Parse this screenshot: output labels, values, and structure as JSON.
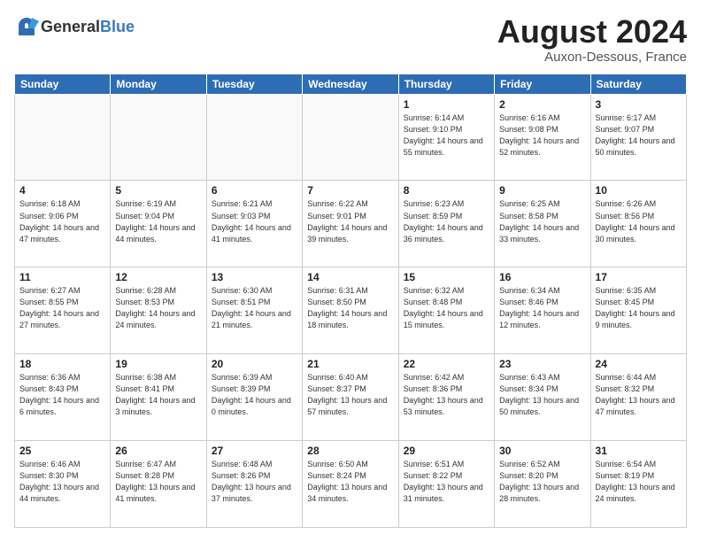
{
  "logo": {
    "general": "General",
    "blue": "Blue"
  },
  "header": {
    "month": "August 2024",
    "location": "Auxon-Dessous, France"
  },
  "weekdays": [
    "Sunday",
    "Monday",
    "Tuesday",
    "Wednesday",
    "Thursday",
    "Friday",
    "Saturday"
  ],
  "weeks": [
    [
      {
        "day": null
      },
      {
        "day": null
      },
      {
        "day": null
      },
      {
        "day": null
      },
      {
        "day": 1,
        "sunrise": "Sunrise: 6:14 AM",
        "sunset": "Sunset: 9:10 PM",
        "daylight": "Daylight: 14 hours and 55 minutes."
      },
      {
        "day": 2,
        "sunrise": "Sunrise: 6:16 AM",
        "sunset": "Sunset: 9:08 PM",
        "daylight": "Daylight: 14 hours and 52 minutes."
      },
      {
        "day": 3,
        "sunrise": "Sunrise: 6:17 AM",
        "sunset": "Sunset: 9:07 PM",
        "daylight": "Daylight: 14 hours and 50 minutes."
      }
    ],
    [
      {
        "day": 4,
        "sunrise": "Sunrise: 6:18 AM",
        "sunset": "Sunset: 9:06 PM",
        "daylight": "Daylight: 14 hours and 47 minutes."
      },
      {
        "day": 5,
        "sunrise": "Sunrise: 6:19 AM",
        "sunset": "Sunset: 9:04 PM",
        "daylight": "Daylight: 14 hours and 44 minutes."
      },
      {
        "day": 6,
        "sunrise": "Sunrise: 6:21 AM",
        "sunset": "Sunset: 9:03 PM",
        "daylight": "Daylight: 14 hours and 41 minutes."
      },
      {
        "day": 7,
        "sunrise": "Sunrise: 6:22 AM",
        "sunset": "Sunset: 9:01 PM",
        "daylight": "Daylight: 14 hours and 39 minutes."
      },
      {
        "day": 8,
        "sunrise": "Sunrise: 6:23 AM",
        "sunset": "Sunset: 8:59 PM",
        "daylight": "Daylight: 14 hours and 36 minutes."
      },
      {
        "day": 9,
        "sunrise": "Sunrise: 6:25 AM",
        "sunset": "Sunset: 8:58 PM",
        "daylight": "Daylight: 14 hours and 33 minutes."
      },
      {
        "day": 10,
        "sunrise": "Sunrise: 6:26 AM",
        "sunset": "Sunset: 8:56 PM",
        "daylight": "Daylight: 14 hours and 30 minutes."
      }
    ],
    [
      {
        "day": 11,
        "sunrise": "Sunrise: 6:27 AM",
        "sunset": "Sunset: 8:55 PM",
        "daylight": "Daylight: 14 hours and 27 minutes."
      },
      {
        "day": 12,
        "sunrise": "Sunrise: 6:28 AM",
        "sunset": "Sunset: 8:53 PM",
        "daylight": "Daylight: 14 hours and 24 minutes."
      },
      {
        "day": 13,
        "sunrise": "Sunrise: 6:30 AM",
        "sunset": "Sunset: 8:51 PM",
        "daylight": "Daylight: 14 hours and 21 minutes."
      },
      {
        "day": 14,
        "sunrise": "Sunrise: 6:31 AM",
        "sunset": "Sunset: 8:50 PM",
        "daylight": "Daylight: 14 hours and 18 minutes."
      },
      {
        "day": 15,
        "sunrise": "Sunrise: 6:32 AM",
        "sunset": "Sunset: 8:48 PM",
        "daylight": "Daylight: 14 hours and 15 minutes."
      },
      {
        "day": 16,
        "sunrise": "Sunrise: 6:34 AM",
        "sunset": "Sunset: 8:46 PM",
        "daylight": "Daylight: 14 hours and 12 minutes."
      },
      {
        "day": 17,
        "sunrise": "Sunrise: 6:35 AM",
        "sunset": "Sunset: 8:45 PM",
        "daylight": "Daylight: 14 hours and 9 minutes."
      }
    ],
    [
      {
        "day": 18,
        "sunrise": "Sunrise: 6:36 AM",
        "sunset": "Sunset: 8:43 PM",
        "daylight": "Daylight: 14 hours and 6 minutes."
      },
      {
        "day": 19,
        "sunrise": "Sunrise: 6:38 AM",
        "sunset": "Sunset: 8:41 PM",
        "daylight": "Daylight: 14 hours and 3 minutes."
      },
      {
        "day": 20,
        "sunrise": "Sunrise: 6:39 AM",
        "sunset": "Sunset: 8:39 PM",
        "daylight": "Daylight: 14 hours and 0 minutes."
      },
      {
        "day": 21,
        "sunrise": "Sunrise: 6:40 AM",
        "sunset": "Sunset: 8:37 PM",
        "daylight": "Daylight: 13 hours and 57 minutes."
      },
      {
        "day": 22,
        "sunrise": "Sunrise: 6:42 AM",
        "sunset": "Sunset: 8:36 PM",
        "daylight": "Daylight: 13 hours and 53 minutes."
      },
      {
        "day": 23,
        "sunrise": "Sunrise: 6:43 AM",
        "sunset": "Sunset: 8:34 PM",
        "daylight": "Daylight: 13 hours and 50 minutes."
      },
      {
        "day": 24,
        "sunrise": "Sunrise: 6:44 AM",
        "sunset": "Sunset: 8:32 PM",
        "daylight": "Daylight: 13 hours and 47 minutes."
      }
    ],
    [
      {
        "day": 25,
        "sunrise": "Sunrise: 6:46 AM",
        "sunset": "Sunset: 8:30 PM",
        "daylight": "Daylight: 13 hours and 44 minutes."
      },
      {
        "day": 26,
        "sunrise": "Sunrise: 6:47 AM",
        "sunset": "Sunset: 8:28 PM",
        "daylight": "Daylight: 13 hours and 41 minutes."
      },
      {
        "day": 27,
        "sunrise": "Sunrise: 6:48 AM",
        "sunset": "Sunset: 8:26 PM",
        "daylight": "Daylight: 13 hours and 37 minutes."
      },
      {
        "day": 28,
        "sunrise": "Sunrise: 6:50 AM",
        "sunset": "Sunset: 8:24 PM",
        "daylight": "Daylight: 13 hours and 34 minutes."
      },
      {
        "day": 29,
        "sunrise": "Sunrise: 6:51 AM",
        "sunset": "Sunset: 8:22 PM",
        "daylight": "Daylight: 13 hours and 31 minutes."
      },
      {
        "day": 30,
        "sunrise": "Sunrise: 6:52 AM",
        "sunset": "Sunset: 8:20 PM",
        "daylight": "Daylight: 13 hours and 28 minutes."
      },
      {
        "day": 31,
        "sunrise": "Sunrise: 6:54 AM",
        "sunset": "Sunset: 8:19 PM",
        "daylight": "Daylight: 13 hours and 24 minutes."
      }
    ]
  ]
}
